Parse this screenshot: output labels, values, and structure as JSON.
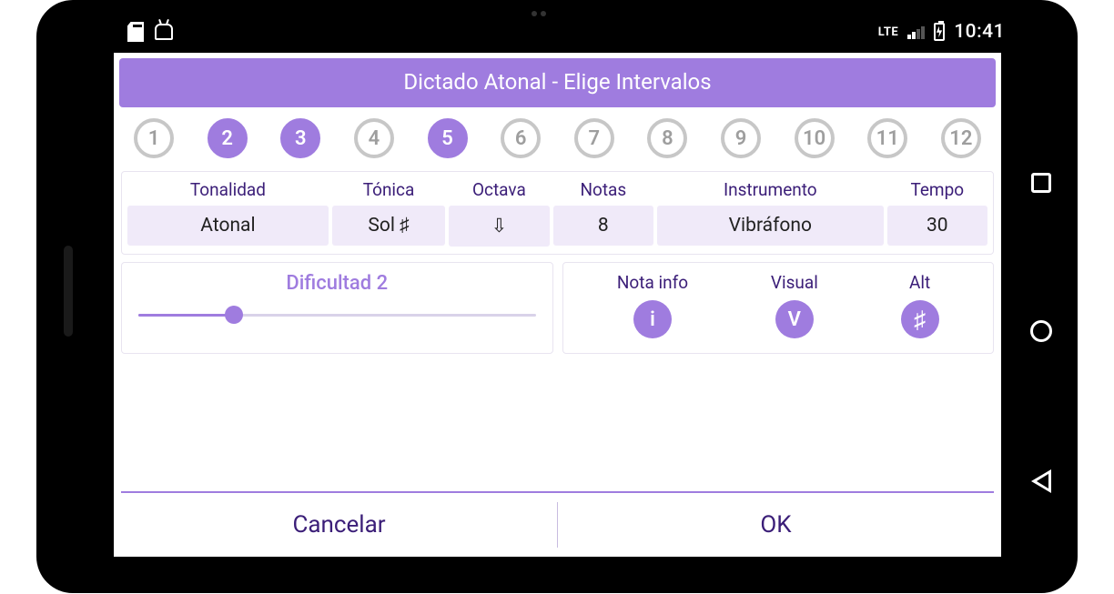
{
  "status": {
    "lte": "LTE",
    "time": "10:41"
  },
  "dialog": {
    "title": "Dictado Atonal - Elige Intervalos"
  },
  "intervals": [
    {
      "n": "1",
      "selected": false
    },
    {
      "n": "2",
      "selected": true
    },
    {
      "n": "3",
      "selected": true
    },
    {
      "n": "4",
      "selected": false
    },
    {
      "n": "5",
      "selected": true
    },
    {
      "n": "6",
      "selected": false
    },
    {
      "n": "7",
      "selected": false
    },
    {
      "n": "8",
      "selected": false
    },
    {
      "n": "9",
      "selected": false
    },
    {
      "n": "10",
      "selected": false
    },
    {
      "n": "11",
      "selected": false
    },
    {
      "n": "12",
      "selected": false
    }
  ],
  "settings": {
    "tonalidad": {
      "label": "Tonalidad",
      "value": "Atonal"
    },
    "tonica": {
      "label": "Tónica",
      "value": "Sol ♯"
    },
    "octava": {
      "label": "Octava",
      "value": "⇩"
    },
    "notas": {
      "label": "Notas",
      "value": "8"
    },
    "instrumento": {
      "label": "Instrumento",
      "value": "Vibráfono"
    },
    "tempo": {
      "label": "Tempo",
      "value": "30"
    }
  },
  "difficulty": {
    "label": "Dificultad 2",
    "percent": 24
  },
  "toggles": {
    "nota": {
      "label": "Nota info",
      "glyph": "i"
    },
    "visual": {
      "label": "Visual",
      "glyph": "V"
    },
    "alt": {
      "label": "Alt",
      "glyph": "♯"
    }
  },
  "buttons": {
    "cancel": "Cancelar",
    "ok": "OK"
  },
  "colors": {
    "accent": "#9f7cdf",
    "text_dark": "#3b1e78",
    "field_bg": "#f0eaf9"
  }
}
